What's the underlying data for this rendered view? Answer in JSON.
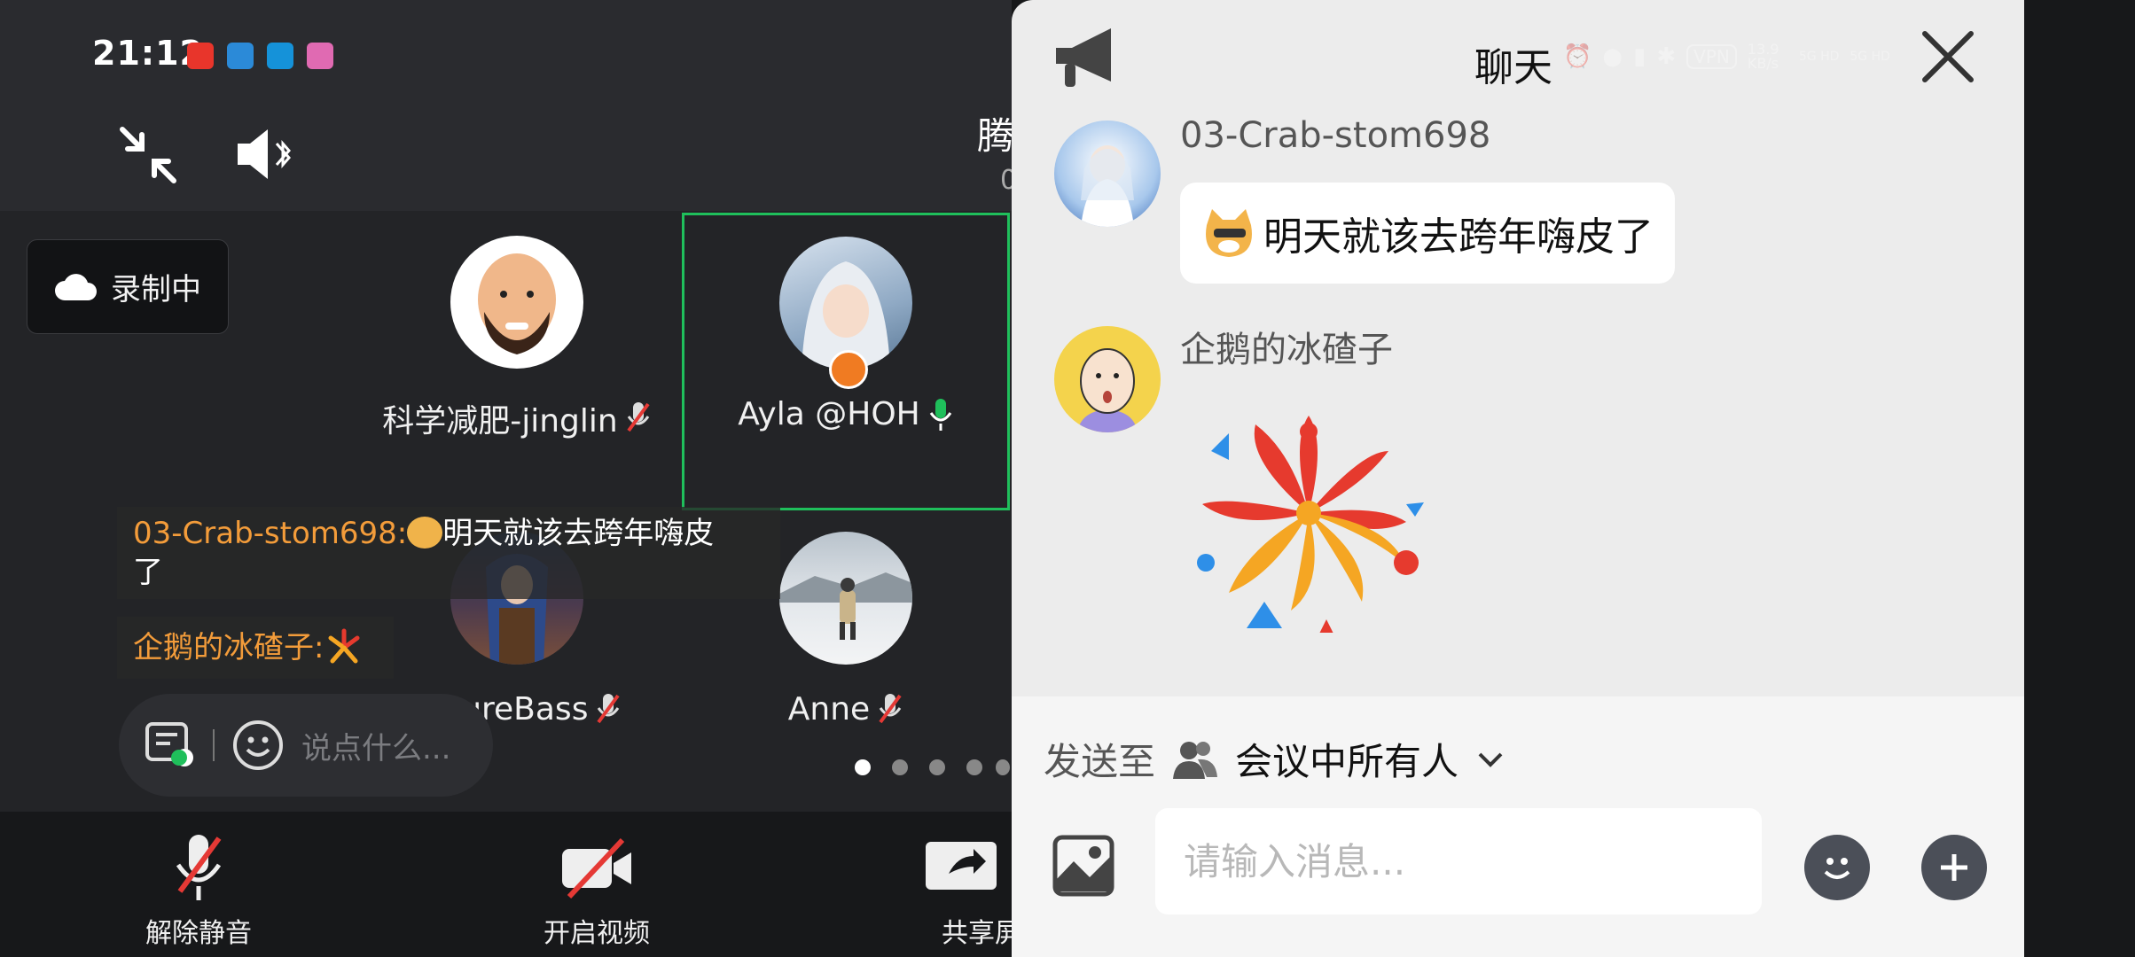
{
  "status_bar": {
    "time": "21:12",
    "app_icons": [
      "qidian-icon",
      "blue-app-icon",
      "edge-browser-icon",
      "pink-app-icon"
    ],
    "indicators": [
      "alarm-icon",
      "mic-icon",
      "vibrate-icon",
      "bluetooth-icon",
      "vpn-icon"
    ],
    "vpn_text": "VPN",
    "net_speed": "13.9 KB/s",
    "signal_1": "5G HD",
    "signal_2": "5G HD"
  },
  "meeting": {
    "title_fragment": "腾",
    "subtitle_fragment": "0",
    "recording_label": "录制中",
    "participants": [
      {
        "name": "科学减肥-jinglin",
        "mic": "muted",
        "avatar": "bald-man-avatar"
      },
      {
        "name": "Ayla @HOH",
        "mic": "active",
        "avatar": "anime-girl-avatar",
        "host": true,
        "speaking": true
      },
      {
        "name": "FutureBass",
        "mic": "muted",
        "avatar": "fantasy-warrior-avatar"
      },
      {
        "name": "Anne",
        "mic": "muted",
        "avatar": "snow-person-avatar"
      }
    ],
    "floating_messages": [
      {
        "sender": "03-Crab-stom698:",
        "text_line1": "明天就该去跨年嗨皮",
        "text_line2": "了"
      },
      {
        "sender": "企鹅的冰碴子:",
        "text": ""
      }
    ],
    "chat_placeholder": "说点什么...",
    "page_dots": 5,
    "toolbar": {
      "unmute_label": "解除静音",
      "video_label": "开启视频",
      "share_label": "共享屏"
    }
  },
  "chat": {
    "title": "聊天",
    "messages": [
      {
        "sender": "03-Crab-stom698",
        "text": "明天就该去跨年嗨皮了",
        "emoji": "doge-emoji"
      },
      {
        "sender": "企鹅的冰碴子",
        "sticker": "firework-sticker"
      }
    ],
    "send_to_label": "发送至",
    "send_to_target": "会议中所有人",
    "input_placeholder": "请输入消息..."
  },
  "colors": {
    "accent_green": "#1fbf5b",
    "sender_orange": "#f39c3a",
    "mute_red": "#e53935",
    "chat_bg": "#ececec"
  }
}
